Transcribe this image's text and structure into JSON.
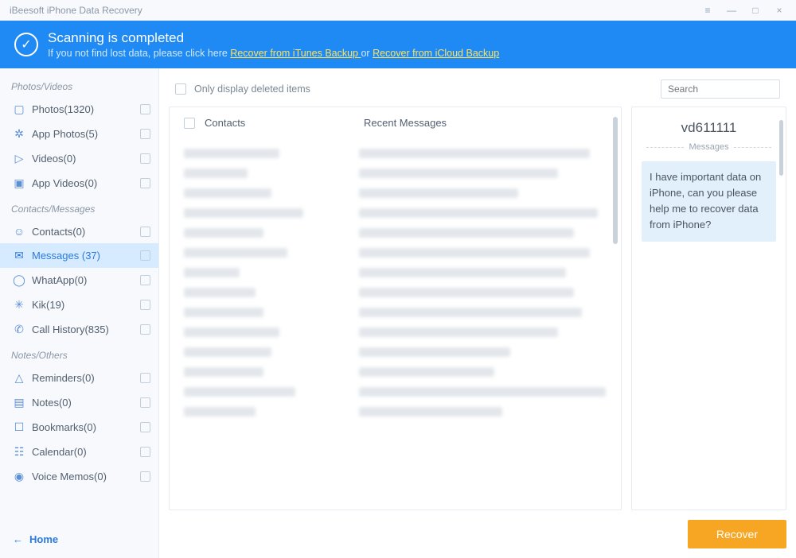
{
  "window": {
    "title": "iBeesoft iPhone Data Recovery",
    "menu_icon": "≡",
    "minimize": "—",
    "maximize": "□",
    "close": "×"
  },
  "banner": {
    "title": "Scanning is completed",
    "sub_prefix": "If you not find lost data, please click here ",
    "link1": "Recover from iTunes Backup ",
    "or": "or ",
    "link2": "Recover from iCloud Backup",
    "check": "✓"
  },
  "sidebar": {
    "groups": [
      {
        "header": "Photos/Videos",
        "items": [
          {
            "icon": "▢",
            "label": "Photos(1320)"
          },
          {
            "icon": "✲",
            "label": "App Photos(5)"
          },
          {
            "icon": "▷",
            "label": "Videos(0)"
          },
          {
            "icon": "▣",
            "label": "App Videos(0)"
          }
        ]
      },
      {
        "header": "Contacts/Messages",
        "items": [
          {
            "icon": "☺",
            "label": "Contacts(0)"
          },
          {
            "icon": "✉",
            "label": "Messages (37)",
            "selected": true
          },
          {
            "icon": "◯",
            "label": "WhatApp(0)"
          },
          {
            "icon": "✳",
            "label": "Kik(19)"
          },
          {
            "icon": "✆",
            "label": "Call History(835)"
          }
        ]
      },
      {
        "header": "Notes/Others",
        "items": [
          {
            "icon": "△",
            "label": "Reminders(0)"
          },
          {
            "icon": "▤",
            "label": "Notes(0)"
          },
          {
            "icon": "☐",
            "label": "Bookmarks(0)"
          },
          {
            "icon": "☷",
            "label": "Calendar(0)"
          },
          {
            "icon": "◉",
            "label": "Voice Memos(0)"
          }
        ]
      }
    ],
    "home": {
      "arrow": "←",
      "label": "Home"
    }
  },
  "toolbar": {
    "only_deleted": "Only display deleted items",
    "search_placeholder": "Search"
  },
  "list": {
    "col1": "Contacts",
    "col2": "Recent Messages"
  },
  "preview": {
    "title": "vd611111",
    "divider": "Messages",
    "body": "I have important data on iPhone, can you please help me to recover data from iPhone?"
  },
  "footer": {
    "recover": "Recover"
  }
}
